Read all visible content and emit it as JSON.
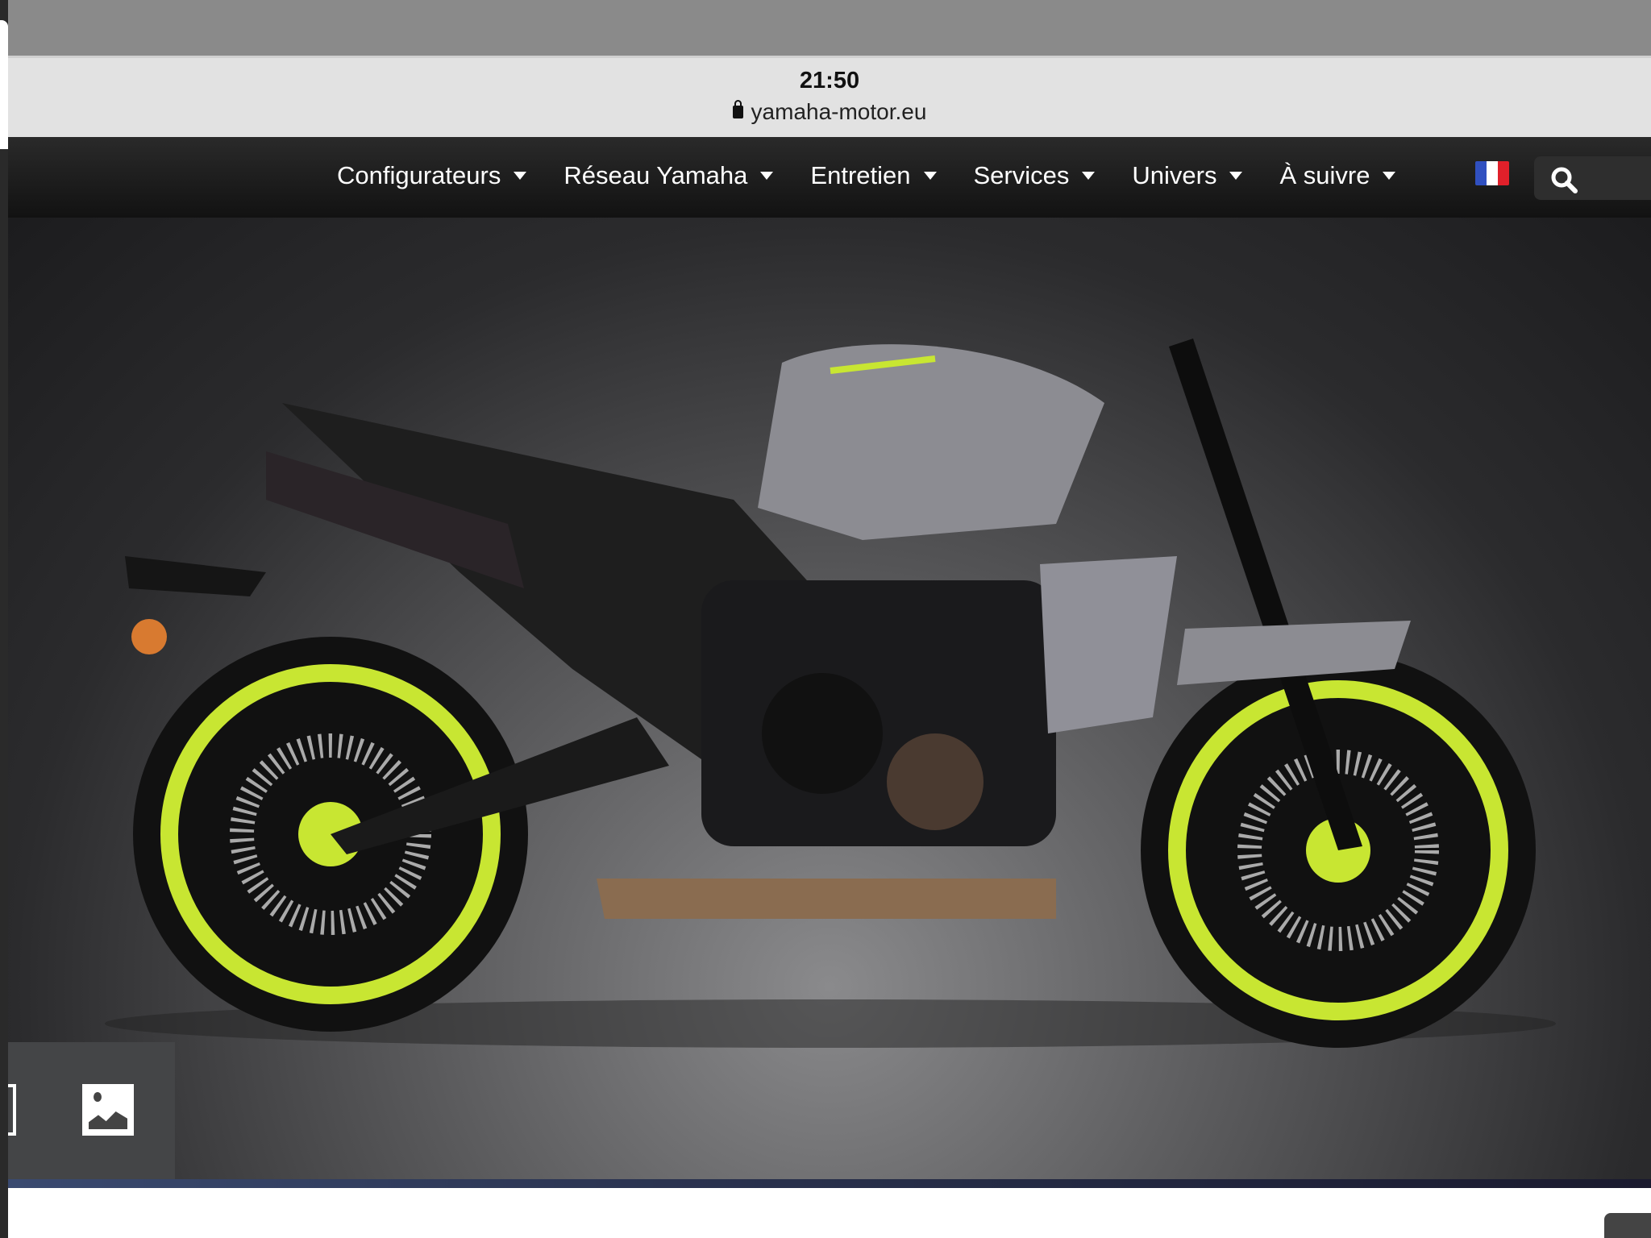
{
  "status_bar": {
    "time": "21:50",
    "url": "yamaha-motor.eu",
    "lock_icon": "lock-icon"
  },
  "nav": {
    "items": [
      {
        "label": "Configurateurs"
      },
      {
        "label": "Réseau Yamaha"
      },
      {
        "label": "Entretien"
      },
      {
        "label": "Services"
      },
      {
        "label": "Univers"
      },
      {
        "label": "À suivre"
      }
    ],
    "language_flag": "french-flag-icon",
    "search_icon": "search-icon"
  },
  "hero": {
    "image": "motorcycle-side-view",
    "accent": "#c8e632"
  },
  "gallery": {
    "icon": "image-icon"
  },
  "colors": {
    "nav_bg": "#1b1b1b",
    "status_bg": "#e2e2e2",
    "accent_wheel": "#c8e632"
  }
}
